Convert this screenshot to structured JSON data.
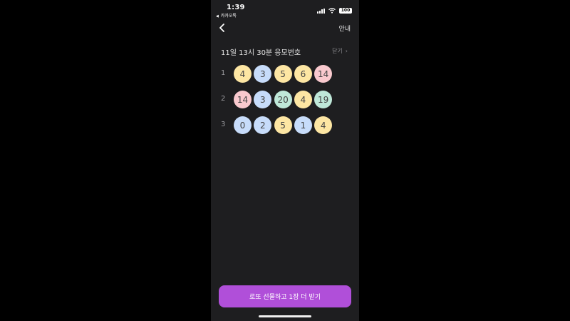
{
  "status": {
    "time": "1:39",
    "back_app": "카카오톡",
    "battery": "100"
  },
  "nav": {
    "guide_label": "안내"
  },
  "section": {
    "title": "11일 13시 30분 응모번호",
    "close_label": "닫기"
  },
  "rows": [
    {
      "label": "1",
      "balls": [
        {
          "number": "4",
          "color": "#fde6a3"
        },
        {
          "number": "3",
          "color": "#c7dcfa"
        },
        {
          "number": "5",
          "color": "#fde6a3"
        },
        {
          "number": "6",
          "color": "#fde6a3"
        },
        {
          "number": "14",
          "color": "#f9c9ce"
        }
      ]
    },
    {
      "label": "2",
      "balls": [
        {
          "number": "14",
          "color": "#f9c9ce"
        },
        {
          "number": "3",
          "color": "#c7dcfa"
        },
        {
          "number": "20",
          "color": "#bfe8d9"
        },
        {
          "number": "4",
          "color": "#fde6a3"
        },
        {
          "number": "19",
          "color": "#bfe8d9"
        }
      ]
    },
    {
      "label": "3",
      "balls": [
        {
          "number": "0",
          "color": "#c7dcfa"
        },
        {
          "number": "2",
          "color": "#c7dcfa"
        },
        {
          "number": "5",
          "color": "#fde6a3"
        },
        {
          "number": "1",
          "color": "#c7dcfa"
        },
        {
          "number": "4",
          "color": "#fde6a3"
        }
      ]
    }
  ],
  "cta": {
    "label": "로또 선물하고 1장 더 받기",
    "color": "#b04fd9"
  },
  "theme": {
    "screen_bg": "#1e1e20",
    "outer_bg": "#000000"
  }
}
